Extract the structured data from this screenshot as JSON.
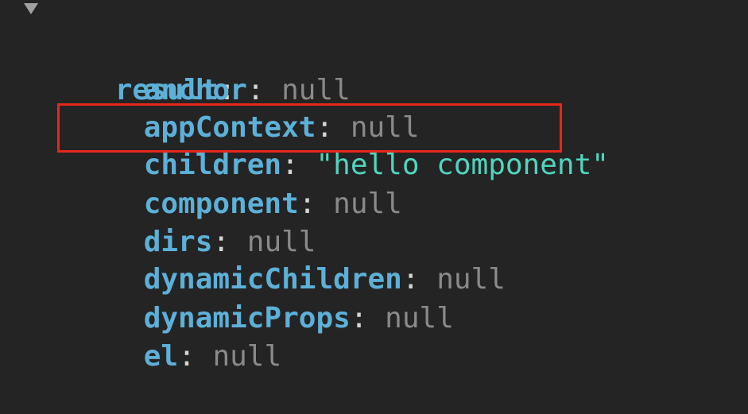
{
  "root": {
    "key": "result",
    "colon": ":",
    "expanded": true,
    "toggle_icon": "triangle-down-icon"
  },
  "properties": [
    {
      "key": "anchor",
      "colon": ":",
      "value": "null",
      "type": "null"
    },
    {
      "key": "appContext",
      "colon": ":",
      "value": "null",
      "type": "null"
    },
    {
      "key": "children",
      "colon": ":",
      "value": "\"hello component\"",
      "type": "string",
      "highlighted": true
    },
    {
      "key": "component",
      "colon": ":",
      "value": "null",
      "type": "null"
    },
    {
      "key": "dirs",
      "colon": ":",
      "value": "null",
      "type": "null"
    },
    {
      "key": "dynamicChildren",
      "colon": ":",
      "value": "null",
      "type": "null"
    },
    {
      "key": "dynamicProps",
      "colon": ":",
      "value": "null",
      "type": "null"
    },
    {
      "key": "el",
      "colon": ":",
      "value": "null",
      "type": "null"
    }
  ],
  "colors": {
    "background": "#242424",
    "key": "#5db0d7",
    "null": "#8a8a8a",
    "string": "#4fd6be",
    "highlight_border": "#e8261a"
  }
}
